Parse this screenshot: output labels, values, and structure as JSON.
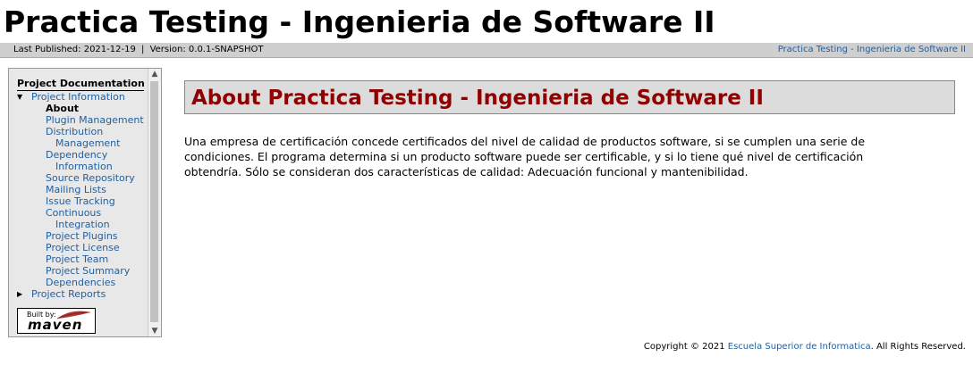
{
  "banner": {
    "title": "Practica Testing - Ingenieria de Software II"
  },
  "breadcrumbs": {
    "published": "Last Published: 2021-12-19",
    "separator": "|",
    "version": "Version: 0.0.1-SNAPSHOT",
    "project_link": "Practica Testing - Ingenieria de Software II"
  },
  "sidebar": {
    "title": "Project Documentation",
    "project_information": "Project Information",
    "items": [
      "About",
      "Plugin Management",
      "Distribution",
      "Management",
      "Dependency",
      "Information",
      "Source Repository",
      "Mailing Lists",
      "Issue Tracking",
      "Continuous",
      "Integration",
      "Project Plugins",
      "Project License",
      "Project Team",
      "Project Summary",
      "Dependencies"
    ],
    "project_reports": "Project Reports",
    "badge": {
      "built_by": "Built by:",
      "maven": "maven"
    }
  },
  "main": {
    "title": "About Practica Testing - Ingenieria de Software II",
    "text": "Una empresa de certificación concede certificados del nivel de calidad de productos software, si se cumplen una serie de condiciones. El programa determina si un producto software puede ser certificable, y si lo tiene qué nivel de certificación obtendría. Sólo se consideran dos características de calidad: Adecuación funcional y mantenibilidad."
  },
  "footer": {
    "prefix": "Copyright © 2021 ",
    "link": "Escuela Superior de Informatica",
    "suffix": ". All Rights Reserved."
  },
  "colors": {
    "link": "#2260a0",
    "heading": "#900000",
    "bar": "#cfcfcf"
  }
}
